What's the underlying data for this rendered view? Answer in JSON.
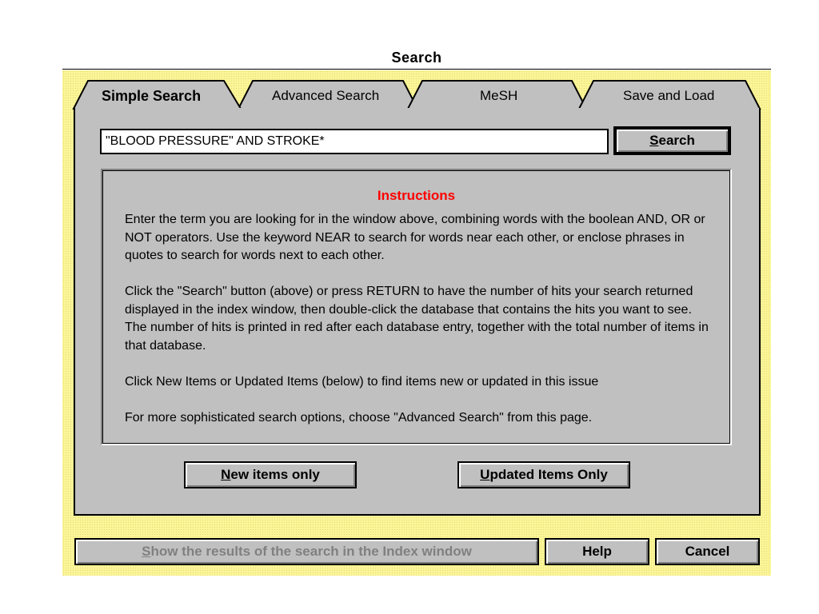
{
  "dialog": {
    "title": "Search"
  },
  "tabs": [
    {
      "label": "Simple Search",
      "active": true
    },
    {
      "label": "Advanced Search",
      "active": false
    },
    {
      "label": "MeSH",
      "active": false
    },
    {
      "label": "Save and Load",
      "active": false
    }
  ],
  "search": {
    "query_value": "\"BLOOD PRESSURE\" AND STROKE*",
    "button_prefix": "",
    "button_mnemonic": "S",
    "button_rest": "earch"
  },
  "instructions": {
    "heading": "Instructions",
    "paragraphs": [
      "Enter the term you are looking for in the window above, combining words with the boolean AND, OR or NOT operators. Use the keyword NEAR to search for words near each other, or enclose phrases in quotes to search for words next to each other.",
      "Click the \"Search\" button (above) or press RETURN to have the number of hits your search returned displayed in the index window, then double-click the database that contains the hits you want to see. The number of hits is printed in red after each database entry, together with the total number of items in that database.",
      "Click New Items or Updated Items (below) to find items new or updated in this issue",
      "For more sophisticated search options, choose \"Advanced Search\" from this page."
    ]
  },
  "filters": {
    "new_mnemonic": "N",
    "new_rest": "ew items only",
    "updated_mnemonic": "U",
    "updated_rest": "pdated Items Only"
  },
  "footer": {
    "show_results_mnemonic": "S",
    "show_results_rest": "how the results of the search in the Index window",
    "help_label": "Help",
    "cancel_label": "Cancel"
  },
  "colors": {
    "frame_background": "#fbf59a",
    "panel_background": "#c0c0c0",
    "instructions_heading": "#ff0000"
  }
}
